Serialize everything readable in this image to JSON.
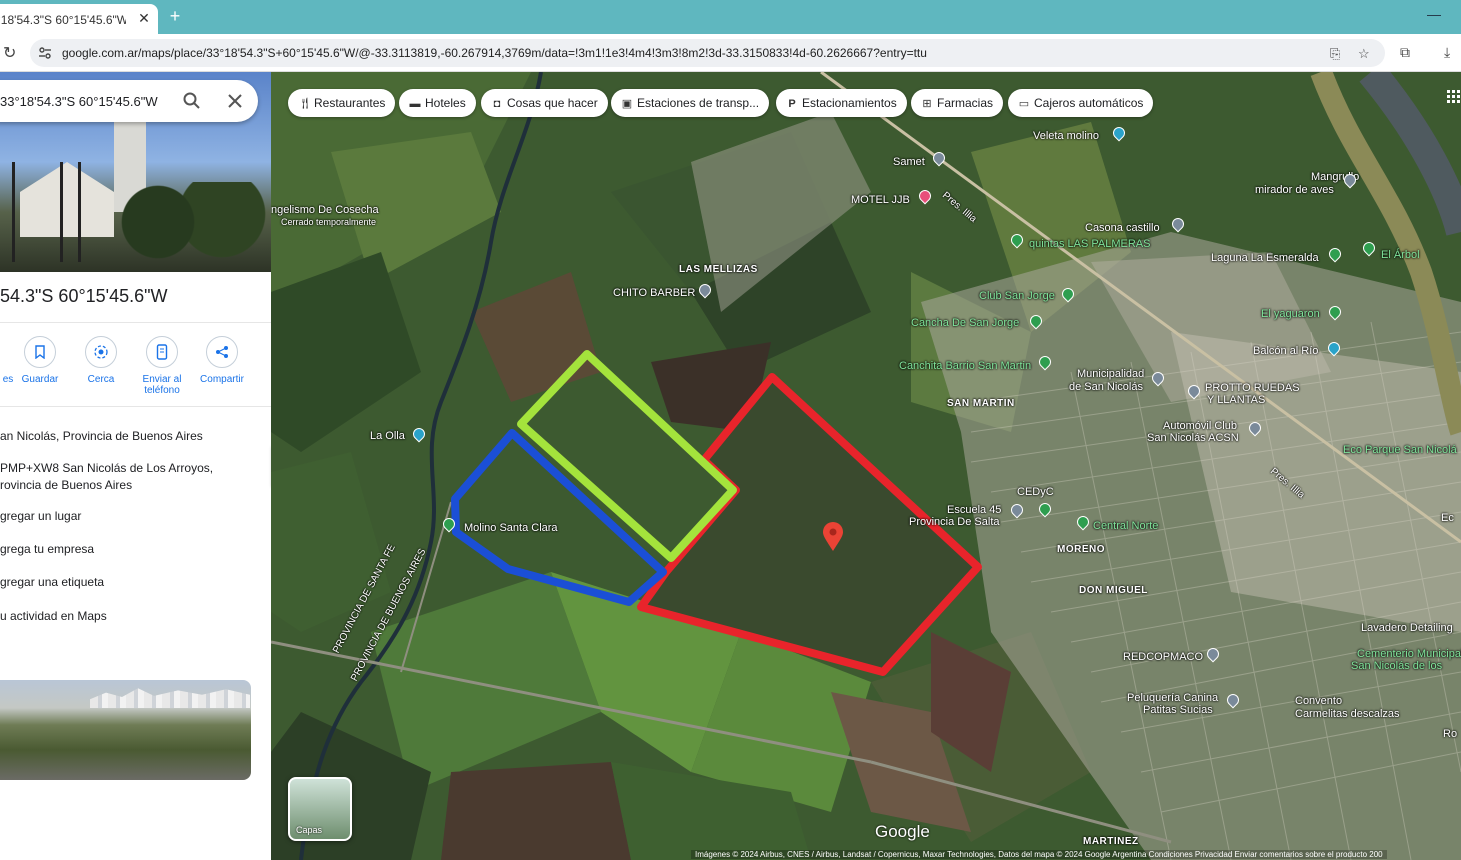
{
  "browser": {
    "tab_title": "°18'54.3\"S 60°15'45.6\"W - Go",
    "new_tab": "+",
    "url": "google.com.ar/maps/place/33°18'54.3\"S+60°15'45.6\"W/@-33.3113819,-60.267914,3769m/data=!3m1!1e3!4m4!3m3!8m2!3d-33.3150833!4d-60.2626667?entry=ttu"
  },
  "panel": {
    "search_value": "33°18'54.3\"S 60°15'45.6\"W",
    "title": "54.3\"S 60°15'45.6\"W",
    "actions": [
      {
        "label": "es",
        "icon": "directions-icon"
      },
      {
        "label": "Guardar",
        "icon": "bookmark-icon"
      },
      {
        "label": "Cerca",
        "icon": "nearby-icon"
      },
      {
        "label": "Enviar al teléfono",
        "icon": "phone-icon"
      },
      {
        "label": "Compartir",
        "icon": "share-icon"
      }
    ],
    "info": {
      "location": "an Nicolás, Provincia de Buenos Aires",
      "pluscode_line1": "PMP+XW8 San Nicolás de Los Arroyos,",
      "pluscode_line2": "rovincia de Buenos Aires",
      "add_place": "gregar un lugar",
      "add_business": "grega tu empresa",
      "add_label": "gregar una etiqueta",
      "activity": "u actividad en Maps"
    }
  },
  "map": {
    "chips": [
      "Restaurantes",
      "Hoteles",
      "Cosas que hacer",
      "Estaciones de transp...",
      "Estacionamientos",
      "Farmacias",
      "Cajeros automáticos"
    ],
    "layers_label": "Capas",
    "google_logo": "Google",
    "attribution": "Imágenes © 2024 Airbus, CNES / Airbus, Landsat / Copernicus, Maxar Technologies, Datos del mapa © 2024 Google    Argentina    Condiciones    Privacidad    Enviar comentarios sobre el producto    200",
    "labels": {
      "veleta": "Veleta molino",
      "samet": "Samet",
      "motel": "MOTEL JJB",
      "mangrullo1": "Mangrullo",
      "mangrullo2": "mirador de aves",
      "evangelismo": "ngelismo De Cosecha",
      "cerrado": "Cerrado temporalmente",
      "casona": "Casona castillo",
      "quintas": "quintas LAS PALMERAS",
      "laguna": "Laguna La Esmeralda",
      "arbol": "El Árbol",
      "mellizas": "LAS MELLIZAS",
      "chito": "CHITO BARBER",
      "club": "Club San Jorge",
      "cancha": "Cancha De San Jorge",
      "yaguaron": "El yaguaron",
      "balcon": "Balcón al Río",
      "canchita": "Canchita Barrio San Martin",
      "muni1": "Municipalidad",
      "muni2": "de San Nicolás",
      "protto1": "PROTTO RUEDAS",
      "protto2": "Y LLANTAS",
      "sanmartin": "SAN MARTIN",
      "automovil1": "Automóvil Club",
      "automovil2": "San Nicolás ACSN",
      "laolla": "La Olla",
      "ecoparque": "Eco Parque San Nicolá",
      "cedyc": "CEDyC",
      "escuela1": "Escuela 45",
      "escuela2": "Provincia De Salta",
      "central": "Central Norte",
      "molino": "Molino Santa Clara",
      "moreno": "MORENO",
      "donmiguel": "DON MIGUEL",
      "provsf": "PROVINCIA DE SANTA FE",
      "provba": "PROVINCIA DE BUENOS AIRES",
      "lavadero": "Lavadero Detailing",
      "cementerio1": "Cementerio Municipal",
      "cementerio2": "San Nicolás de los",
      "redcop": "REDCOPMACO",
      "peluqueria1": "Peluquería Canina",
      "peluqueria2": "Patitas Sucias",
      "convento1": "Convento",
      "convento2": "Carmelitas descalzas",
      "martinez": "MARTINEZ",
      "presillia": "Pres. Illia",
      "pellegrini": "Pres. Illia",
      "ec": "Ec",
      "ro": "Ro"
    },
    "colors": {
      "red": "#e8242b",
      "green": "#a4e33c",
      "blue": "#1b4fd6",
      "pin": "#ea4335"
    }
  }
}
